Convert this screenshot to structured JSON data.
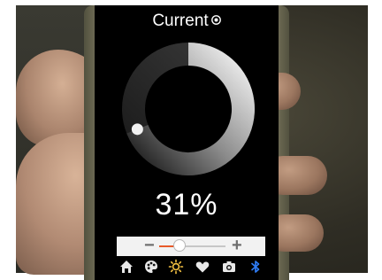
{
  "screen": {
    "title": "Current",
    "title_icon": "gear-icon",
    "percent_text": "31%",
    "dial_level": 0.31
  },
  "slider": {
    "minus_label": "−",
    "plus_label": "+",
    "value": 0.31
  },
  "tabs": [
    {
      "icon": "home-icon"
    },
    {
      "icon": "palette-icon"
    },
    {
      "icon": "sun-icon",
      "active": true
    },
    {
      "icon": "heart-icon"
    },
    {
      "icon": "camera-icon"
    },
    {
      "icon": "bluetooth-icon"
    }
  ],
  "colors": {
    "active_tab": "#f5c242",
    "bluetooth": "#2e7cf6",
    "slider_fill": "#e85a2a"
  }
}
